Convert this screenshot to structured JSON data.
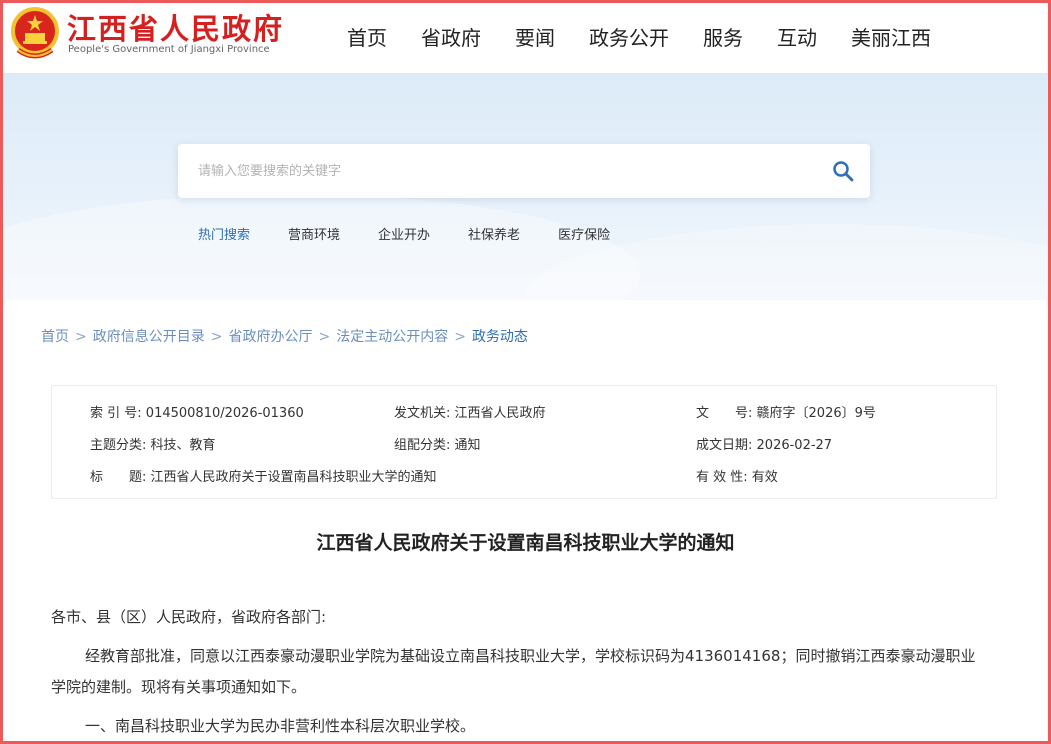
{
  "header": {
    "title": "江西省人民政府",
    "subtitle": "People's Government of Jiangxi Province",
    "nav": [
      "首页",
      "省政府",
      "要闻",
      "政务公开",
      "服务",
      "互动",
      "美丽江西"
    ]
  },
  "search": {
    "placeholder": "请输入您要搜索的关键字",
    "hot_label": "热门搜索",
    "hot_items": [
      "营商环境",
      "企业开办",
      "社保养老",
      "医疗保险"
    ]
  },
  "breadcrumb": [
    "首页",
    "政府信息公开目录",
    "省政府办公厅",
    "法定主动公开内容",
    "政务动态"
  ],
  "breadcrumb_sep": ">",
  "meta": {
    "index_label": "索 引 号:",
    "index_value": "014500810/2026-01360",
    "issuer_label": "发文机关:",
    "issuer_value": "江西省人民政府",
    "docno_label": "文　　号:",
    "docno_value": "赣府字〔2026〕9号",
    "topic_label": "主题分类:",
    "topic_value": "科技、教育",
    "form_label": "组配分类:",
    "form_value": "通知",
    "date_label": "成文日期:",
    "date_value": "2026-02-27",
    "title_label": "标　　题:",
    "title_value": "江西省人民政府关于设置南昌科技职业大学的通知",
    "valid_label": "有 效 性:",
    "valid_value": "有效"
  },
  "document": {
    "title": "江西省人民政府关于设置南昌科技职业大学的通知",
    "salutation": "各市、县（区）人民政府，省政府各部门:",
    "para1_line1": "经教育部批准，同意以江西泰豪动漫职业学院为基础设立南昌科技职业大学，学校标识码为4136014168；同时撤销江西泰豪动漫职业",
    "para1_line2": "学院的建制。现将有关事项通知如下。",
    "para2": "一、南昌科技职业大学为民办非营利性本科层次职业学校。"
  },
  "colors": {
    "brand_red": "#d52020",
    "link_blue": "#2f6fb6",
    "frame_red": "#ec5a5a"
  },
  "icons": [
    "national-emblem-icon",
    "search-icon"
  ]
}
